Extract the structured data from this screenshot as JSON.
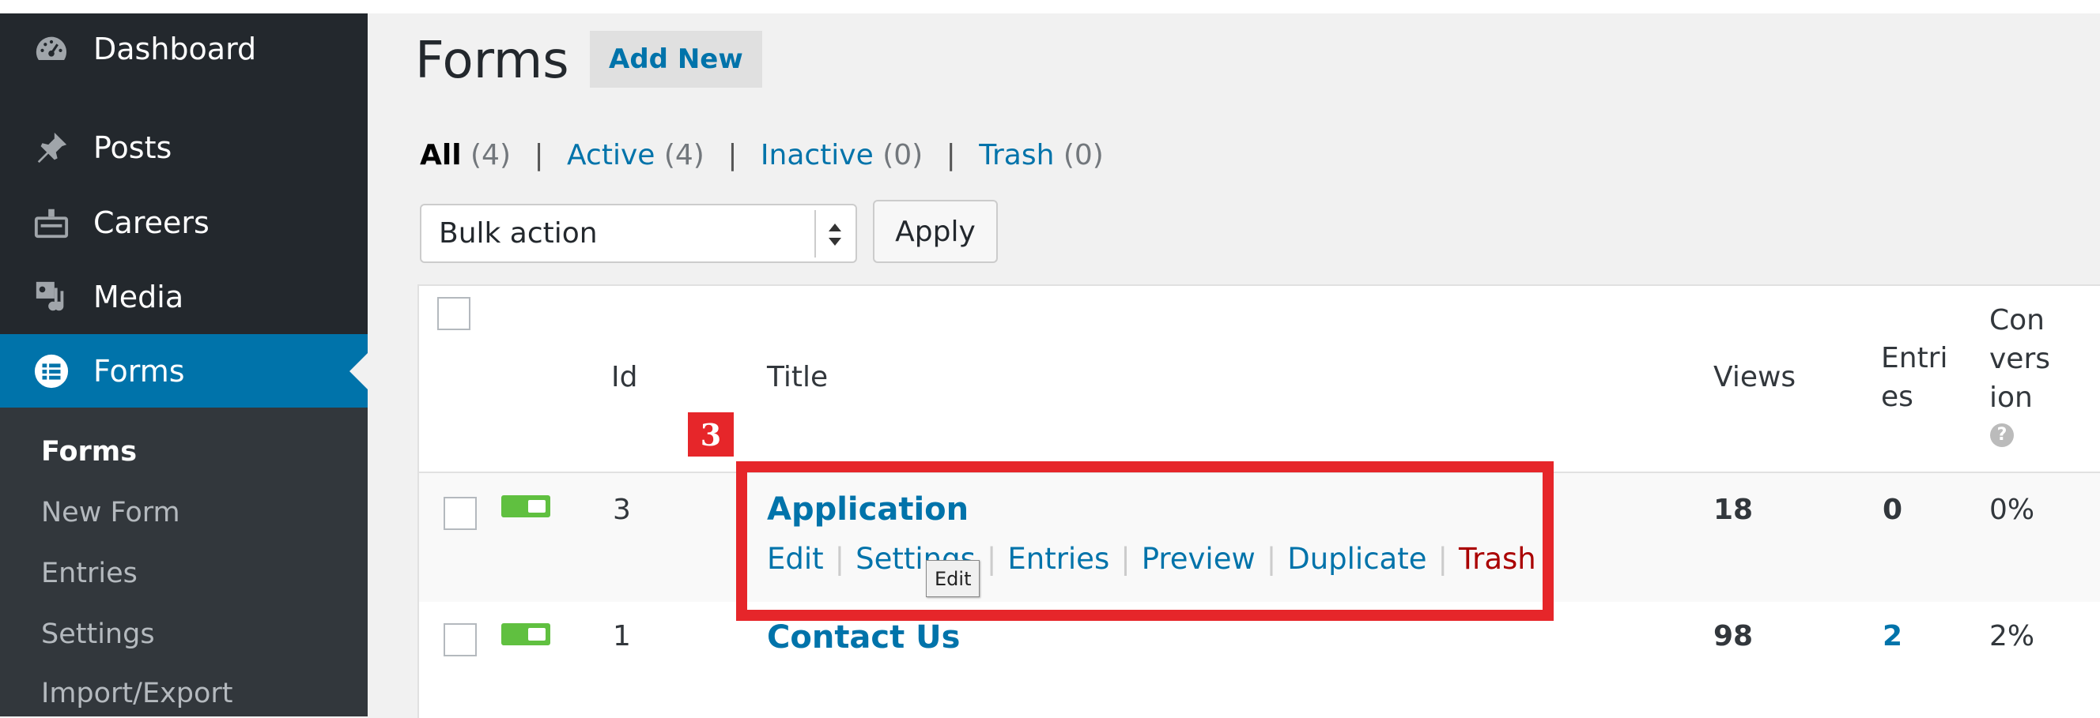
{
  "sidebar": {
    "menu": [
      {
        "label": "Dashboard",
        "icon": "dashboard-icon"
      },
      {
        "label": "Posts",
        "icon": "pin-icon"
      },
      {
        "label": "Careers",
        "icon": "careers-icon"
      },
      {
        "label": "Media",
        "icon": "media-icon"
      },
      {
        "label": "Forms",
        "icon": "forms-icon",
        "active": true
      }
    ],
    "submenu": [
      "Forms",
      "New Form",
      "Entries",
      "Settings",
      "Import/Export"
    ]
  },
  "page": {
    "title": "Forms",
    "add_new": "Add New"
  },
  "filters": {
    "all": {
      "label": "All",
      "count": "(4)"
    },
    "active": {
      "label": "Active",
      "count": "(4)"
    },
    "inactive": {
      "label": "Inactive",
      "count": "(0)"
    },
    "trash": {
      "label": "Trash",
      "count": "(0)"
    },
    "separator": "|"
  },
  "bulk": {
    "selected": "Bulk action",
    "apply": "Apply"
  },
  "table": {
    "headers": {
      "id": "Id",
      "title": "Title",
      "views": "Views",
      "entries": [
        "Entri",
        "es"
      ],
      "conversion": [
        "Con",
        "vers",
        "ion"
      ],
      "help": "?"
    },
    "rows": [
      {
        "id": "3",
        "title": "Application",
        "views": "18",
        "entries": "0",
        "conversion": "0%"
      },
      {
        "id": "1",
        "title": "Contact Us",
        "views": "98",
        "entries": "2",
        "conversion": "2%"
      }
    ],
    "row_actions": [
      "Edit",
      "Settings",
      "Entries",
      "Preview",
      "Duplicate",
      "Trash"
    ]
  },
  "annotation": {
    "step": "3",
    "tooltip": "Edit",
    "color": "#e6262a"
  },
  "colors": {
    "sidebar": "#23282d",
    "accent": "#0073aa",
    "toggle_on": "#60c040",
    "trash": "#aa0000"
  }
}
